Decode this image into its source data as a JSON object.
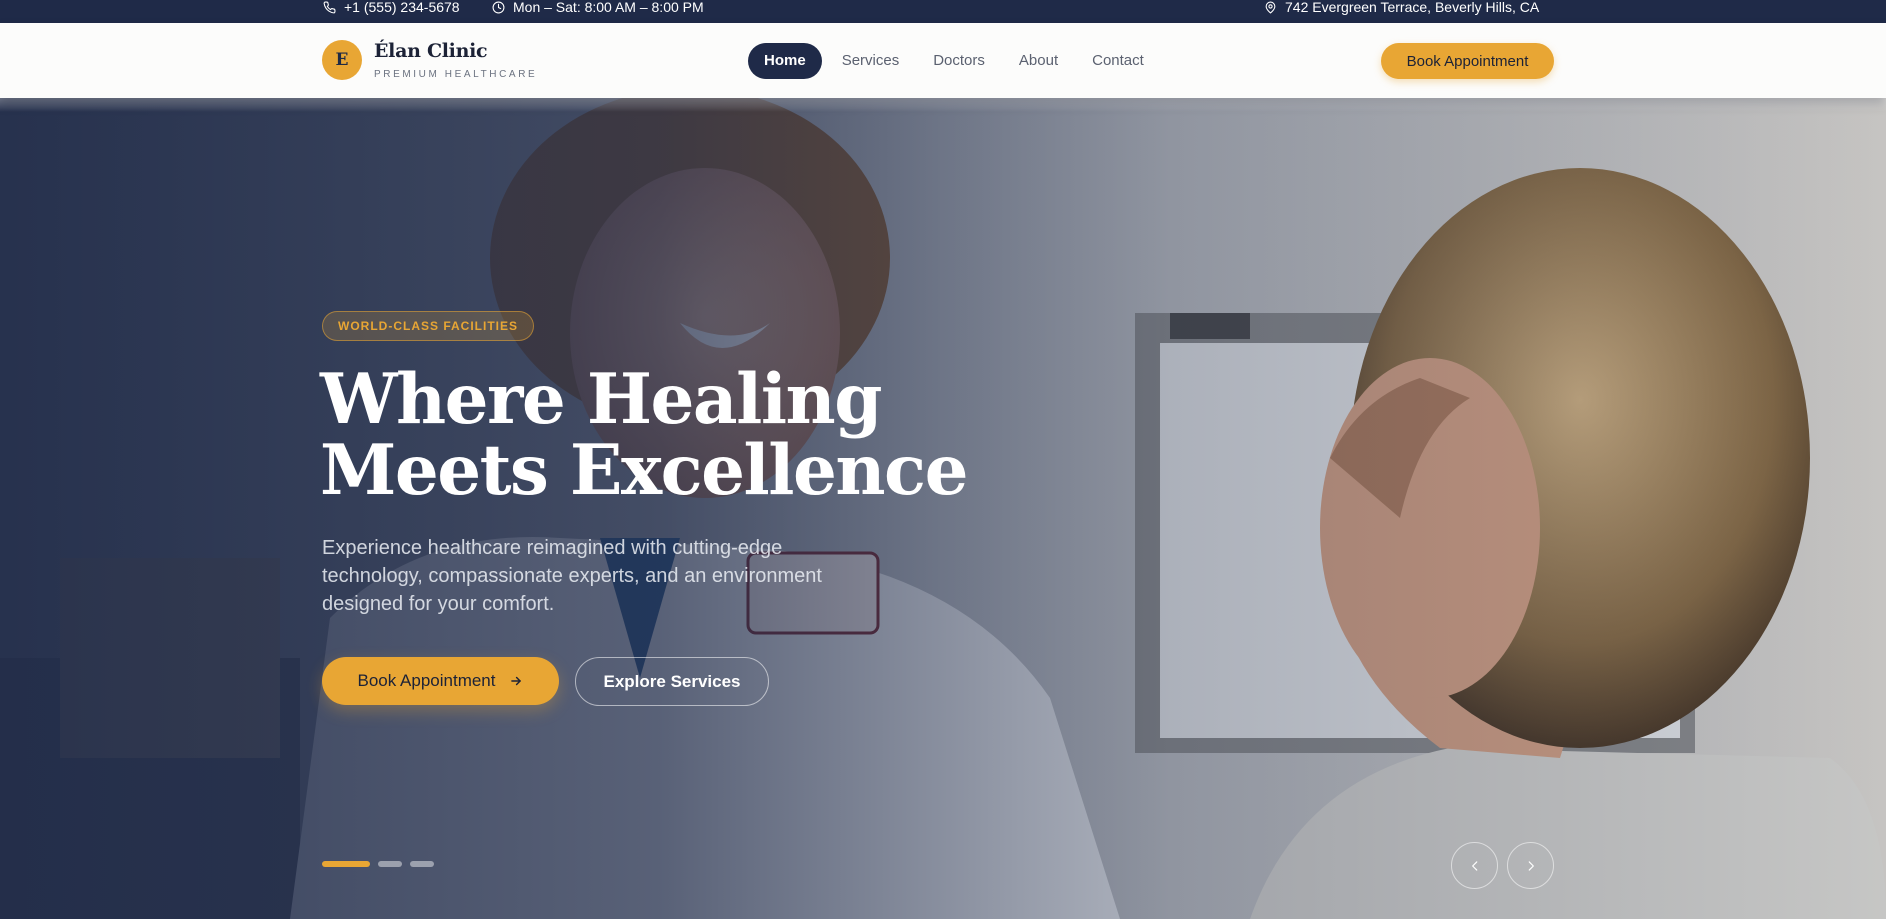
{
  "topbar": {
    "phone": "+1 (555) 234-5678",
    "hours": "Mon – Sat: 8:00 AM – 8:00 PM",
    "address": "742 Evergreen Terrace, Beverly Hills, CA"
  },
  "header": {
    "logo_letter": "E",
    "brand_name": "Élan Clinic",
    "brand_tagline": "PREMIUM HEALTHCARE",
    "nav": {
      "home": "Home",
      "services": "Services",
      "doctors": "Doctors",
      "about": "About",
      "contact": "Contact"
    },
    "active_nav": "Home",
    "cta_label": "Book Appointment"
  },
  "hero": {
    "badge": "WORLD-CLASS FACILITIES",
    "title_line1": "Where Healing",
    "title_line2": "Meets Excellence",
    "description": "Experience healthcare reimagined with cutting-edge technology, compassionate experts, and an environment designed for your comfort.",
    "primary_cta": "Book Appointment",
    "secondary_cta": "Explore Services",
    "slides_total": 3,
    "active_slide": 1
  },
  "icons": {
    "phone": "phone-icon",
    "clock": "clock-icon",
    "location": "map-pin-icon",
    "arrow": "arrow-right-icon",
    "prev": "chevron-left-icon",
    "next": "chevron-right-icon"
  },
  "colors": {
    "navy": "#1f2a48",
    "gold": "#e8a634",
    "header_bg": "#fcfcfb",
    "white": "#ffffff"
  }
}
